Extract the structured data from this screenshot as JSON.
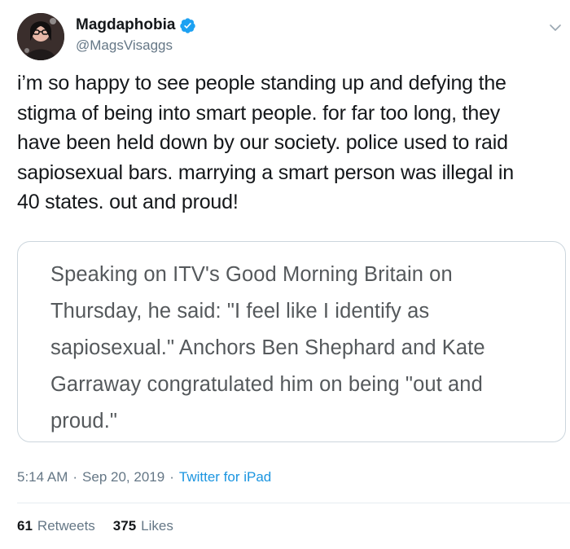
{
  "author": {
    "display_name": "Magdaphobia",
    "handle": "@MagsVisaggs",
    "verified": true,
    "avatar_icon": "avatar-photo-icon"
  },
  "menu_icon": "chevron-down-icon",
  "tweet": {
    "text": "i’m so happy to see people standing up and defying the\nstigma of being into smart people. for far too long, they\nhave been held down by our society. police used to raid\nsapiosexual bars.  marrying a smart person was illegal in\n40 states. out and proud!"
  },
  "quote": {
    "text": "Speaking on ITV's Good Morning Britain on\nThursday, he said: \"I feel like I identify as\nsapiosexual.\" Anchors Ben Shephard and Kate\nGarraway congratulated him on being \"out and\nproud.\""
  },
  "meta": {
    "time": "5:14 AM",
    "separator": "·",
    "date": "Sep 20, 2019",
    "source": "Twitter for iPad"
  },
  "stats": {
    "retweets_count": "61",
    "retweets_label": "Retweets",
    "likes_count": "375",
    "likes_label": "Likes"
  },
  "colors": {
    "text_primary": "#14171a",
    "text_secondary": "#657786",
    "link": "#1b95e0",
    "verified": "#1da1f2",
    "border": "#ccd6dd"
  }
}
